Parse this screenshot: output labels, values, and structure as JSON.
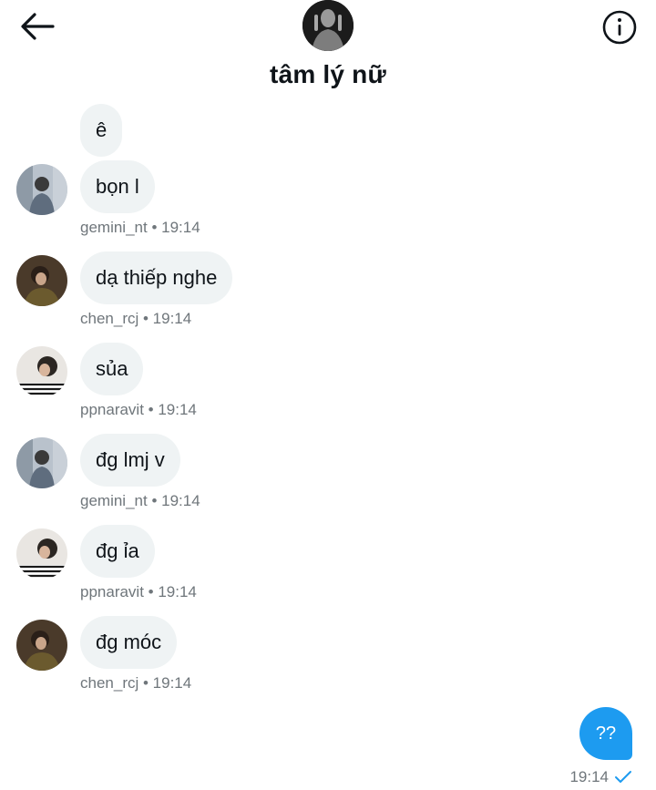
{
  "header": {
    "title": "tâm lý nữ",
    "icons": {
      "back": "arrow-left-icon",
      "info": "info-circle-icon"
    }
  },
  "messages": [
    {
      "text": "ê"
    },
    {
      "text": "bọn l",
      "user": "gemini_nt",
      "time": "19:14"
    },
    {
      "text": "dạ thiếp nghe",
      "user": "chen_rcj",
      "time": "19:14"
    },
    {
      "text": "sủa",
      "user": "ppnaravit",
      "time": "19:14"
    },
    {
      "text": "đg lmj v",
      "user": "gemini_nt",
      "time": "19:14"
    },
    {
      "text": "đg ỉa",
      "user": "ppnaravit",
      "time": "19:14"
    },
    {
      "text": "đg móc",
      "user": "chen_rcj",
      "time": "19:14"
    }
  ],
  "outgoing": {
    "text": "??",
    "time": "19:14",
    "status_icon": "check-icon"
  },
  "colors": {
    "accent": "#1d9bf0",
    "bubble_in": "#eff3f4",
    "meta": "#6f767b"
  }
}
